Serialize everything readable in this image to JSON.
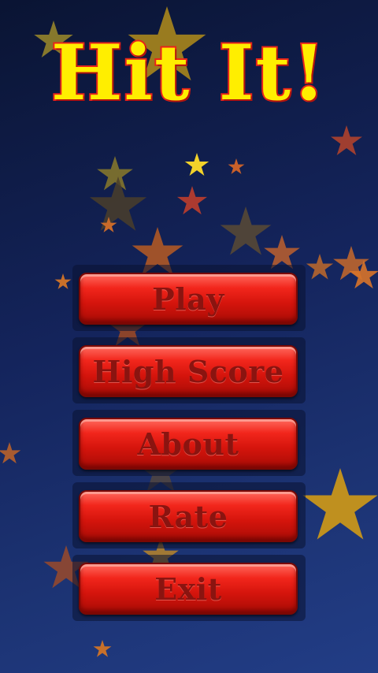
{
  "game": {
    "title": "Hit It!",
    "title_color": "#ffee00",
    "title_outline_color": "#e8231a"
  },
  "menu": {
    "items": [
      {
        "label": "Play"
      },
      {
        "label": "High Score"
      },
      {
        "label": "About"
      },
      {
        "label": "Rate"
      },
      {
        "label": "Exit"
      }
    ],
    "button_color": "#e31e16",
    "label_color": "#8a1410"
  },
  "background": {
    "gradient_top": "#0a1433",
    "gradient_bottom": "#223d86",
    "star_colors": [
      "#f2c21a",
      "#e0962a",
      "#c8502a",
      "#8a6a3a"
    ],
    "decoration": "star-icon"
  }
}
